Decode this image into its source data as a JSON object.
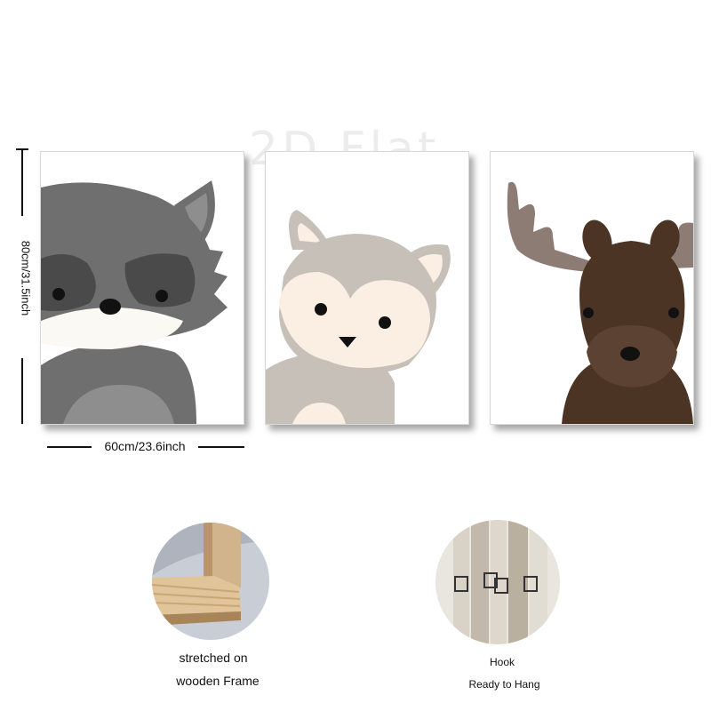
{
  "watermark": "2D Flat",
  "dimensions": {
    "height_label": "80cm/31.5inch",
    "width_label": "60cm/23.6inch"
  },
  "panels": [
    {
      "animal": "raccoon",
      "fur": "#6f6f6f",
      "mask": "#4a4a4a",
      "muzzle": "#fbf9f3",
      "belly": "#8e8e8e"
    },
    {
      "animal": "fox",
      "fur": "#c7c0b9",
      "muzzle": "#fbeee2",
      "ear_inner": "#fbeee2"
    },
    {
      "animal": "moose",
      "fur": "#4c3424",
      "antler": "#8c7c74",
      "muzzle": "#5c4232"
    }
  ],
  "details": [
    {
      "caption_line1": "stretched on",
      "caption_line2": "wooden Frame"
    },
    {
      "caption_line1": "Hook",
      "caption_line2": "Ready to Hang"
    }
  ]
}
